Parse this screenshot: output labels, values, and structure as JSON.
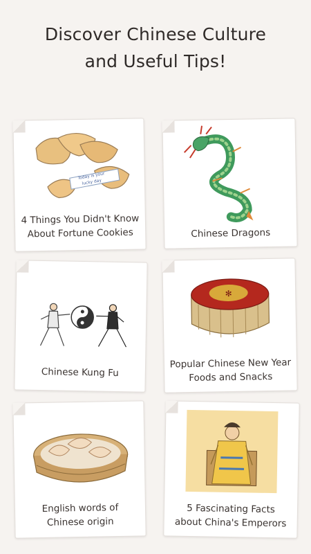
{
  "header": {
    "title_line1": "Discover Chinese Culture",
    "title_line2": "and Useful Tips!"
  },
  "cards": [
    {
      "line1": "4 Things You Didn't Know",
      "line2": "About Fortune Cookies",
      "illustration": "fortune-cookies",
      "paper_text_1": "Today is your",
      "paper_text_2": "lucky day"
    },
    {
      "line1": "Chinese Dragons",
      "line2": "",
      "illustration": "dragon"
    },
    {
      "line1": "Chinese Kung Fu",
      "line2": "",
      "illustration": "kung-fu-yin-yang"
    },
    {
      "line1": "Popular Chinese New Year",
      "line2": "Foods and Snacks",
      "illustration": "nian-gao-cake"
    },
    {
      "line1": "English words of",
      "line2": "Chinese origin",
      "illustration": "dumplings-steamer"
    },
    {
      "line1": "5 Fascinating Facts",
      "line2": "about China's Emperors",
      "illustration": "emperor"
    }
  ],
  "colors": {
    "background": "#f6f3f0",
    "card": "#ffffff",
    "text": "#3a3330"
  }
}
